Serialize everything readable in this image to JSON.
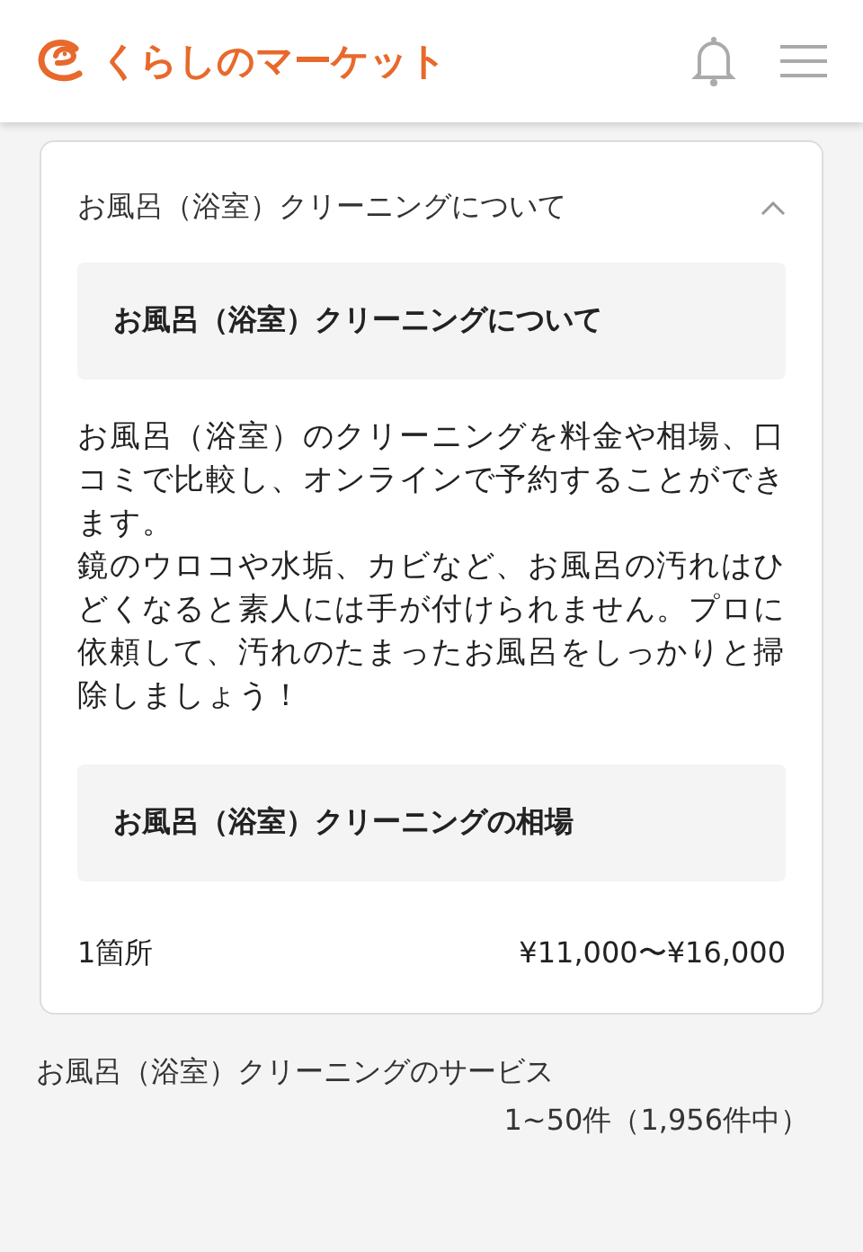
{
  "header": {
    "logo_text": "くらしのマーケット"
  },
  "accordion": {
    "title": "お風呂（浴室）クリーニングについて",
    "expanded": true,
    "sections": [
      {
        "heading": "お風呂（浴室）クリーニングについて",
        "paragraphs": [
          "お風呂（浴室）のクリーニングを料金や相場、口コミで比較し、オンラインで予約することができます。",
          "鏡のウロコや水垢、カビなど、お風呂の汚れはひどくなると素人には手が付けられません。プロに依頼して、汚れのたまったお風呂をしっかりと掃除しましょう！"
        ]
      },
      {
        "heading": "お風呂（浴室）クリーニングの相場",
        "price_rows": [
          {
            "label": "1箇所",
            "price": "¥11,000〜¥16,000"
          }
        ]
      }
    ]
  },
  "services": {
    "title": "お風呂（浴室）クリーニングのサービス",
    "count": "1~50件（1,956件中）"
  }
}
